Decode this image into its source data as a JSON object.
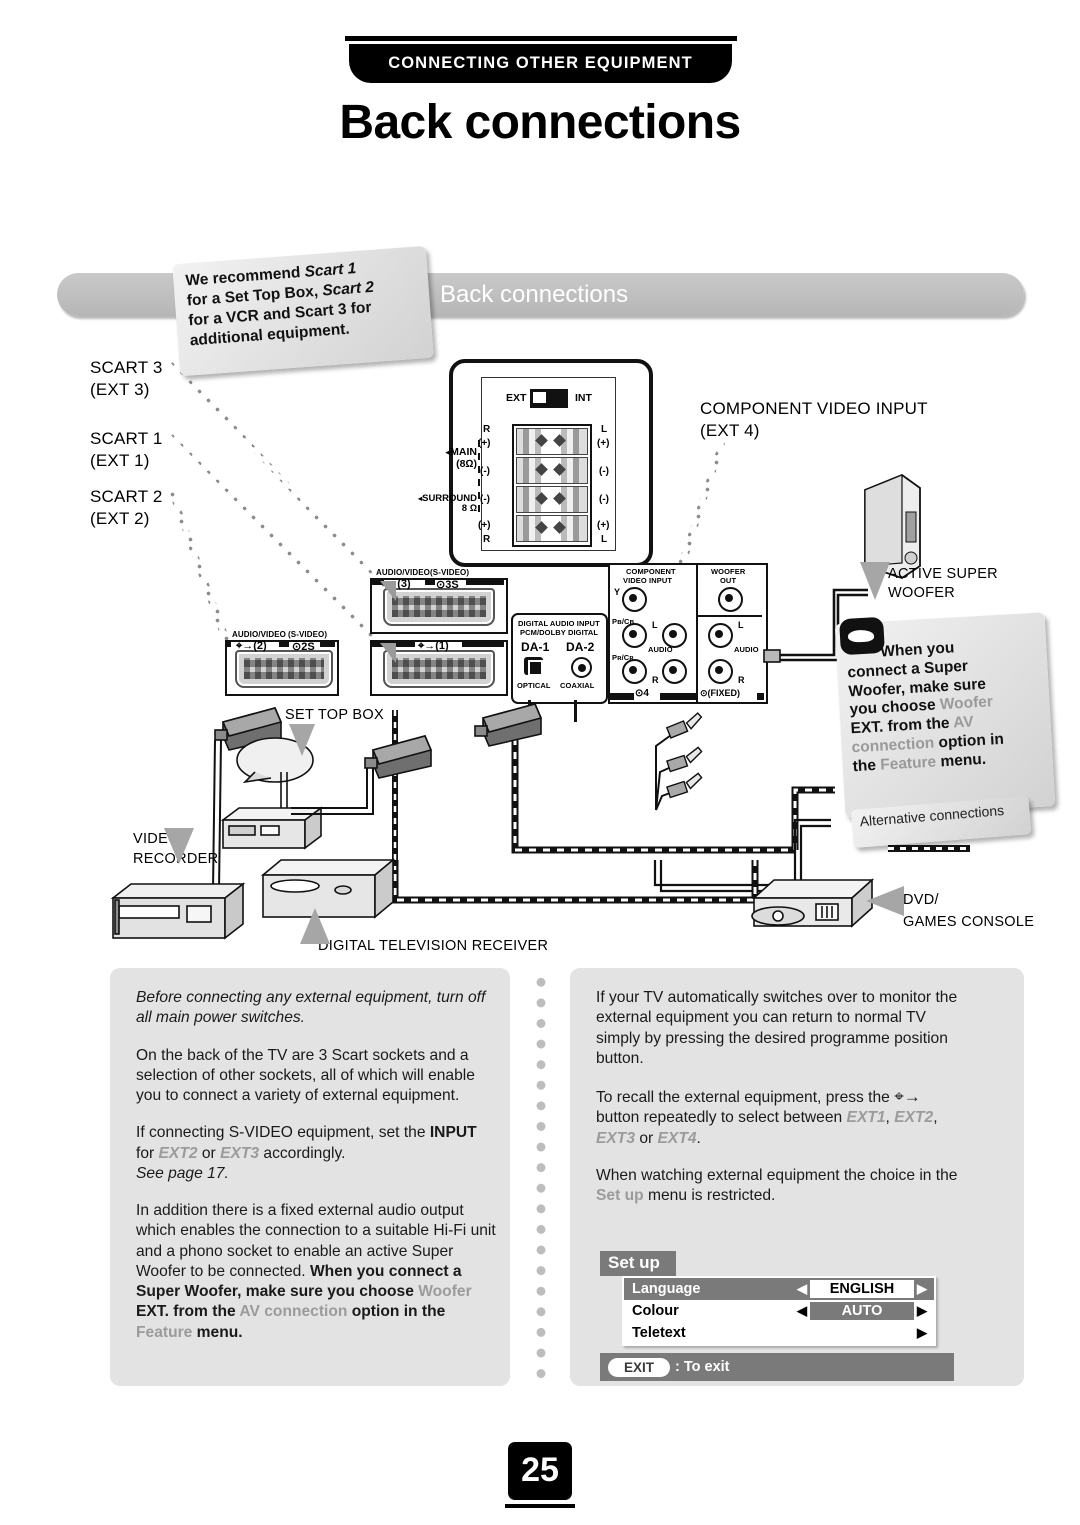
{
  "header": {
    "kicker": "CONNECTING OTHER EQUIPMENT",
    "title": "Back connections"
  },
  "diagram": {
    "bar_title": "Back connections",
    "bubbles": {
      "scart_tip_line1": "We recommend ",
      "scart_tip_em1": "Scart 1",
      "scart_tip_line2": "for a Set Top Box, ",
      "scart_tip_em2": "Scart 2",
      "scart_tip_line3": "for a VCR and Scart 3 for",
      "scart_tip_line4": "additional equipment.",
      "woofer_tip": "When you connect a Super Woofer, make sure you choose Woofer EXT. from the AV connection option in the Feature menu.",
      "woofer_tip_parts": [
        "When you",
        "connect a Super",
        "Woofer, make sure",
        "you choose ",
        "Woofer",
        "EXT. from the ",
        "AV",
        "connection",
        " option in",
        "the ",
        "Feature",
        " menu."
      ],
      "alternative_connections": "Alternative connections"
    },
    "labels": {
      "scart3": "SCART 3",
      "scart3_ext": "(EXT 3)",
      "scart1": "SCART 1",
      "scart1_ext": "(EXT 1)",
      "scart2": "SCART 2",
      "scart2_ext": "(EXT 2)",
      "component_video_input": "COMPONENT VIDEO INPUT",
      "component_ext": "(EXT 4)",
      "active_super_woofer_1": "ACTIVE SUPER",
      "active_super_woofer_2": "WOOFER",
      "set_top_box": "SET TOP BOX",
      "video_recorder_1": "VIDEO",
      "video_recorder_2": "RECORDER",
      "digital_tv_receiver": "DIGITAL TELEVISION RECEIVER",
      "dvd_1": "DVD/",
      "dvd_2": "GAMES CONSOLE"
    },
    "speaker_panel": {
      "ext": "EXT",
      "int": "INT",
      "main": "MAIN",
      "main_ohm": "(8Ω)",
      "surround": "SURROUND",
      "surround_ohm": "8 Ω",
      "left_pins": [
        "R",
        "(+)",
        "(-)",
        "(-)",
        "(+)",
        "R"
      ],
      "right_pins": [
        "L",
        "(+)",
        "(-)",
        "(-)",
        "(+)",
        "L"
      ]
    },
    "sockets": {
      "audio_video": "AUDIO/VIDEO",
      "s_video": "(S-VIDEO)",
      "scart3_num": "(3)",
      "scart3_s": "3S",
      "scart2_num": "(2)",
      "scart2_s": "2S",
      "scart1_num": "(1)",
      "digital_audio_input": "DIGITAL AUDIO INPUT",
      "pcm_dolby": "PCM/DOLBY DIGITAL",
      "da1": "DA-1",
      "da2": "DA-2",
      "optical": "OPTICAL",
      "coaxial": "COAXIAL",
      "component_line1": "COMPONENT",
      "component_line2": "VIDEO INPUT",
      "y": "Y",
      "pb_cb": "Pв/Cв",
      "pr_cr": "Pʀ/Cʀ",
      "audio": "AUDIO",
      "L": "L",
      "R": "R",
      "woofer_out_1": "WOOFER",
      "woofer_out_2": "OUT",
      "ext4": "4",
      "fixed": "(FIXED)"
    }
  },
  "left_column": {
    "p1_italic": "Before connecting any external equipment, turn off all main power switches.",
    "p2": "On the back of the TV are 3 Scart sockets and a selection of other sockets, all of which will enable you to connect a variety of external equipment.",
    "p3_a": "If connecting S-VIDEO equipment, set the ",
    "p3_input": "INPUT",
    "p3_b": " for ",
    "p3_ext2": "EXT2",
    "p3_c": " or ",
    "p3_ext3": "EXT3",
    "p3_d": " accordingly.",
    "p3_see": "See page 17.",
    "p4_a": "In addition there is a fixed external audio output which enables the connection to a suitable Hi-Fi unit and a phono socket to enable an active Super Woofer to be connected. ",
    "p4_bold1": "When you connect a Super Woofer, make sure you choose ",
    "p4_gray1": "Woofer",
    "p4_bold2": " EXT. from the ",
    "p4_gray2": "AV connection",
    "p4_bold3": " option in the ",
    "p4_gray3": "Feature",
    "p4_bold4": " menu."
  },
  "right_column": {
    "p1": "If your TV automatically switches over to monitor the external equipment you can return to normal TV simply by pressing the desired programme position button.",
    "p2_a": "To recall the external equipment, press the ",
    "p2_b": " button repeatedly to select between ",
    "p2_ext1": "EXT1",
    "p2_c": ", ",
    "p2_ext2": "EXT2",
    "p2_d": ", ",
    "p2_ext3": "EXT3",
    "p2_e": " or ",
    "p2_ext4": "EXT4",
    "p2_f": ".",
    "p3_a": "When watching external equipment the choice in the ",
    "p3_setup": "Set up",
    "p3_b": " menu is restricted."
  },
  "setup_menu": {
    "tab": "Set up",
    "rows": [
      {
        "name": "Language",
        "value": "ENGLISH",
        "left_arrow": "◀",
        "right_arrow": "▶",
        "selected": true
      },
      {
        "name": "Colour",
        "value": "AUTO",
        "left_arrow": "◀",
        "right_arrow": "▶",
        "selected": false
      },
      {
        "name": "Teletext",
        "value": "",
        "left_arrow": "",
        "right_arrow": "▶",
        "selected": false
      }
    ],
    "exit_button": "EXIT",
    "exit_text": ": To exit"
  },
  "page_number": "25",
  "colors": {
    "panel_gray": "#e3e3e3",
    "bar_gray": "#c0c0c0",
    "menu_gray": "#7a7a7a",
    "dim_text": "#9b9b9b"
  }
}
